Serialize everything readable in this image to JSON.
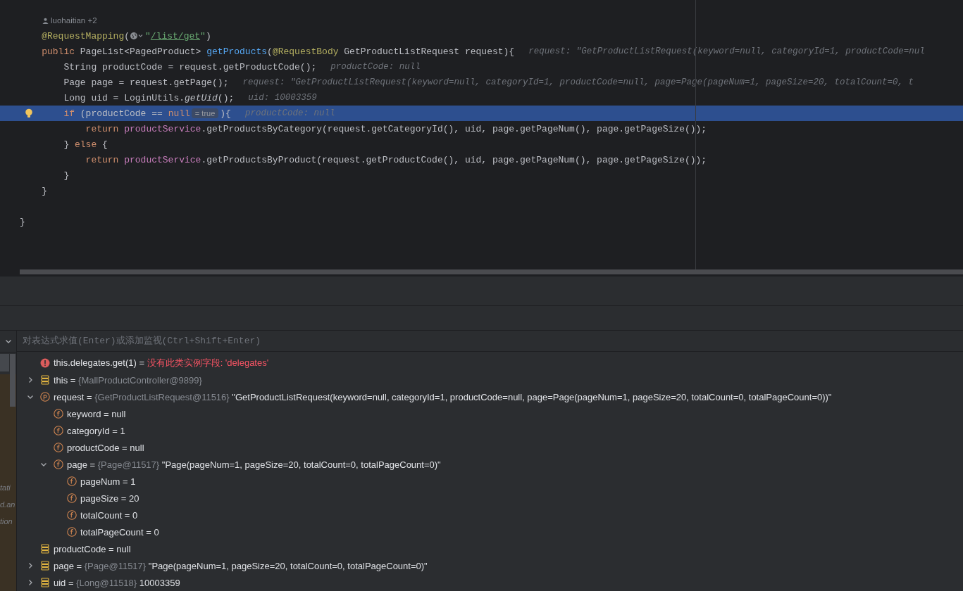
{
  "editor": {
    "lines": [
      {
        "current": false,
        "parts": [
          {
            "kind": "author",
            "text": "luohaitian +2"
          }
        ]
      },
      {
        "current": false,
        "parts": [
          {
            "kind": "code",
            "tokens": [
              {
                "kind": "ann",
                "text": "    @RequestMapping"
              },
              {
                "kind": "plain",
                "text": "("
              }
            ]
          },
          {
            "kind": "globe"
          },
          {
            "kind": "code",
            "tokens": [
              {
                "kind": "str",
                "text": "\""
              },
              {
                "kind": "link",
                "text": "/list/get"
              },
              {
                "kind": "str",
                "text": "\""
              },
              {
                "kind": "plain",
                "text": ")"
              }
            ]
          }
        ]
      },
      {
        "current": false,
        "parts": [
          {
            "kind": "code",
            "tokens": [
              {
                "kind": "kw",
                "text": "    public "
              },
              {
                "kind": "plain",
                "text": "PageList<PagedProduct> "
              },
              {
                "kind": "method",
                "text": "getProducts"
              },
              {
                "kind": "plain",
                "text": "("
              },
              {
                "kind": "ann",
                "text": "@RequestBody"
              },
              {
                "kind": "plain",
                "text": " GetProductListRequest request){"
              }
            ]
          },
          {
            "kind": "hint",
            "text": "request: \"GetProductListRequest(keyword=null, categoryId=1, productCode=nul"
          }
        ]
      },
      {
        "current": false,
        "parts": [
          {
            "kind": "code",
            "tokens": [
              {
                "kind": "plain",
                "text": "        String productCode = request.getProductCode();"
              }
            ]
          },
          {
            "kind": "hint",
            "text": "productCode: null"
          }
        ]
      },
      {
        "current": false,
        "parts": [
          {
            "kind": "code",
            "tokens": [
              {
                "kind": "plain",
                "text": "        Page page = request.getPage();"
              }
            ]
          },
          {
            "kind": "hint",
            "text": "request: \"GetProductListRequest(keyword=null, categoryId=1, productCode=null, page=Page(pageNum=1, pageSize=20, totalCount=0, t"
          }
        ]
      },
      {
        "current": false,
        "parts": [
          {
            "kind": "code",
            "tokens": [
              {
                "kind": "plain",
                "text": "        Long uid = LoginUtils."
              },
              {
                "kind": "static",
                "text": "getUid"
              },
              {
                "kind": "plain",
                "text": "();"
              }
            ]
          },
          {
            "kind": "hint",
            "text": "uid: 10003359"
          }
        ]
      },
      {
        "current": true,
        "parts": [
          {
            "kind": "code",
            "tokens": [
              {
                "kind": "kw",
                "text": "        if"
              },
              {
                "kind": "plain",
                "text": " (productCode == "
              },
              {
                "kind": "kw",
                "text": "null"
              }
            ]
          },
          {
            "kind": "badge",
            "text": "= true"
          },
          {
            "kind": "code",
            "tokens": [
              {
                "kind": "plain",
                "text": "){"
              }
            ]
          },
          {
            "kind": "hint",
            "text": "productCode: null"
          }
        ]
      },
      {
        "current": false,
        "parts": [
          {
            "kind": "code",
            "tokens": [
              {
                "kind": "kw",
                "text": "            return "
              },
              {
                "kind": "field",
                "text": "productService"
              },
              {
                "kind": "plain",
                "text": ".getProductsByCategory(request.getCategoryId(), uid, page.getPageNum(), page.getPageSize());"
              }
            ]
          }
        ]
      },
      {
        "current": false,
        "parts": [
          {
            "kind": "code",
            "tokens": [
              {
                "kind": "plain",
                "text": "        } "
              },
              {
                "kind": "kw",
                "text": "else"
              },
              {
                "kind": "plain",
                "text": " {"
              }
            ]
          }
        ]
      },
      {
        "current": false,
        "parts": [
          {
            "kind": "code",
            "tokens": [
              {
                "kind": "kw",
                "text": "            return "
              },
              {
                "kind": "field",
                "text": "productService"
              },
              {
                "kind": "plain",
                "text": ".getProductsByProduct(request.getProductCode(), uid, page.getPageNum(), page.getPageSize());"
              }
            ]
          }
        ]
      },
      {
        "current": false,
        "parts": [
          {
            "kind": "code",
            "tokens": [
              {
                "kind": "plain",
                "text": "        }"
              }
            ]
          }
        ]
      },
      {
        "current": false,
        "parts": [
          {
            "kind": "code",
            "tokens": [
              {
                "kind": "plain",
                "text": "    }"
              }
            ]
          }
        ]
      },
      {
        "current": false
      },
      {
        "current": false,
        "parts": [
          {
            "kind": "code",
            "tokens": [
              {
                "kind": "plain",
                "text": "}"
              }
            ]
          }
        ]
      }
    ]
  },
  "frames_panel": {
    "texts": [
      "tati",
      "d.an",
      "tion"
    ]
  },
  "evaluate": {
    "placeholder": "对表达式求值(Enter)或添加监视(Ctrl+Shift+Enter)"
  },
  "variables": [
    {
      "kind": "error",
      "label": "this.delegates.get(1) =",
      "value": "没有此类实例字段: 'delegates'"
    },
    {
      "kind": "local",
      "label": "this =",
      "type": "{MallProductController@9899}",
      "expanded": false
    },
    {
      "kind": "param",
      "label": "request =",
      "type": "{GetProductListRequest@11516}",
      "value": "\"GetProductListRequest(keyword=null, categoryId=1, productCode=null, page=Page(pageNum=1, pageSize=20, totalCount=0, totalPageCount=0))\"",
      "expanded": true,
      "children": [
        {
          "kind": "field",
          "label": "keyword =",
          "value": "null"
        },
        {
          "kind": "field",
          "label": "categoryId =",
          "value": "1"
        },
        {
          "kind": "field",
          "label": "productCode =",
          "value": "null"
        },
        {
          "kind": "field",
          "label": "page =",
          "type": "{Page@11517}",
          "value": "\"Page(pageNum=1, pageSize=20, totalCount=0, totalPageCount=0)\"",
          "expanded": true,
          "children": [
            {
              "kind": "field",
              "label": "pageNum =",
              "value": "1"
            },
            {
              "kind": "field",
              "label": "pageSize =",
              "value": "20"
            },
            {
              "kind": "field",
              "label": "totalCount =",
              "value": "0"
            },
            {
              "kind": "field",
              "label": "totalPageCount =",
              "value": "0"
            }
          ]
        }
      ]
    },
    {
      "kind": "local",
      "label": "productCode =",
      "value": "null"
    },
    {
      "kind": "local",
      "label": "page =",
      "type": "{Page@11517}",
      "value": "\"Page(pageNum=1, pageSize=20, totalCount=0, totalPageCount=0)\"",
      "expanded": false
    },
    {
      "kind": "local",
      "label": "uid =",
      "type": "{Long@11518}",
      "value": "10003359",
      "expanded": false
    }
  ]
}
